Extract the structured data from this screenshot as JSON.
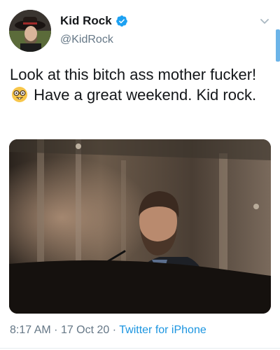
{
  "tweet": {
    "display_name": "Kid Rock",
    "handle": "@KidRock",
    "text_part1": "Look at this bitch ass mother fucker!",
    "emoji": "nerd-face-emoji",
    "text_part2": "Have a great weekend. Kid rock.",
    "time": "8:17 AM",
    "separator": "·",
    "date": "17 Oct 20",
    "source": "Twitter for iPhone"
  },
  "colors": {
    "verified": "#1da1f2",
    "link": "#1b95e0",
    "secondary_text": "#657786"
  },
  "icons": {
    "verified": "verified-badge-icon",
    "menu": "chevron-down-icon"
  }
}
